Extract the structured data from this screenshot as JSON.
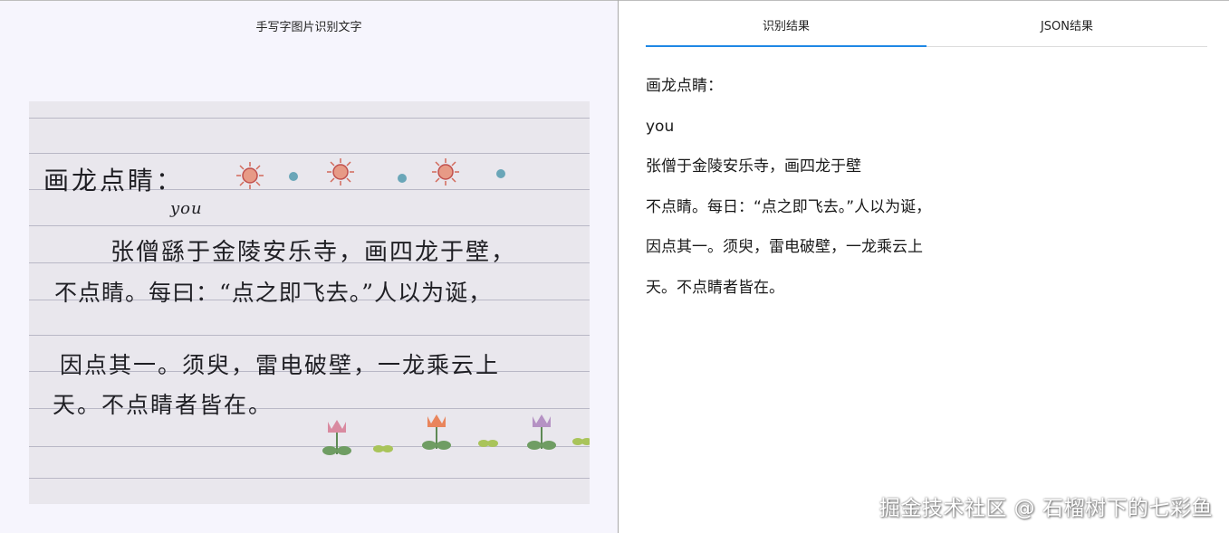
{
  "left_panel": {
    "title": "手写字图片识别文字",
    "image": {
      "handwritten_lines": [
        "画龙点睛：",
        "you",
        "张僧繇于金陵安乐寺，画四龙于壁，",
        "不点睛。每曰：“点之即飞去。”人以为诞，",
        "因点其一。须臾，雷电破壁，一龙乘云上",
        "天。不点睛者皆在。"
      ],
      "decorations": [
        "sun-icon",
        "dot-icon",
        "sun-icon",
        "dot-icon",
        "sun-icon",
        "dot-icon",
        "flower-icon",
        "leaf-icon",
        "flower-icon",
        "leaf-icon",
        "flower-icon",
        "leaf-icon"
      ]
    }
  },
  "right_panel": {
    "tabs": [
      {
        "label": "识别结果",
        "active": true
      },
      {
        "label": "JSON结果",
        "active": false
      }
    ],
    "accent_color": "#1e88e5",
    "result_lines": [
      "画龙点睛：",
      "you",
      "张僧于金陵安乐寺，画四龙于壁",
      "不点睛。每日：“点之即飞去。”人以为诞，",
      "因点其一。须臾，雷电破壁，一龙乘云上",
      "天。不点睛者皆在。"
    ]
  },
  "watermark": "掘金技术社区 @ 石榴树下的七彩鱼"
}
